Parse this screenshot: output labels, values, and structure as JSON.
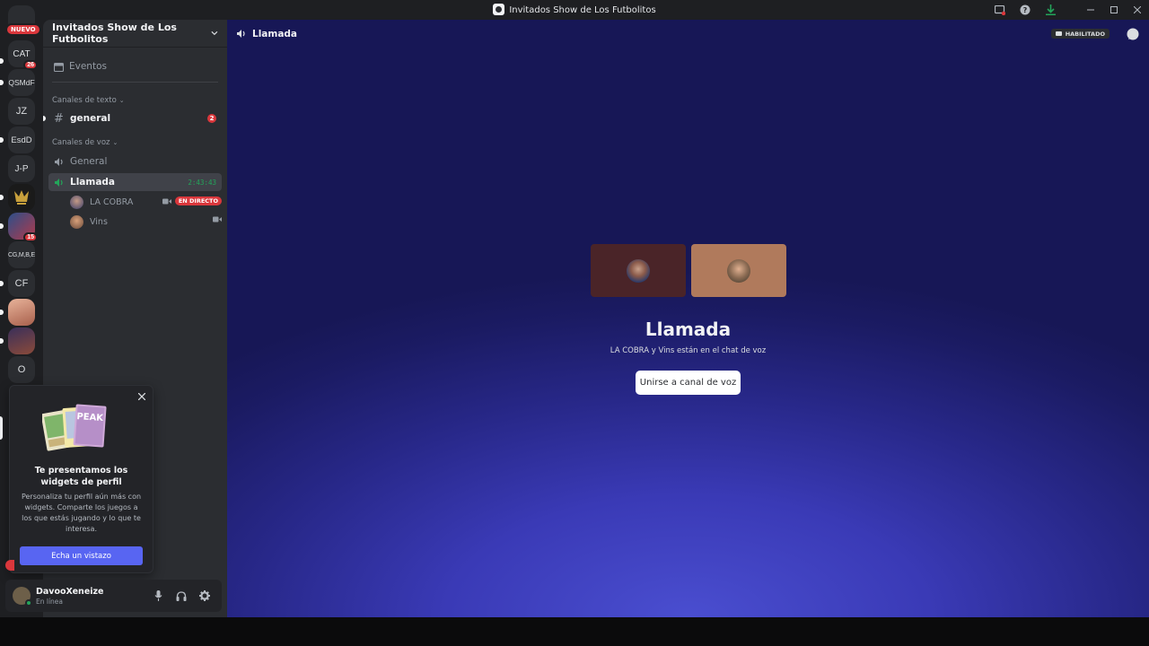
{
  "window": {
    "title": "Invitados Show de Los Futbolitos"
  },
  "rail": {
    "new_badge": "NUEVO",
    "servers": [
      {
        "label": "CAT",
        "badge": "26"
      },
      {
        "label": "QSMdF",
        "badge": ""
      },
      {
        "label": "JZ",
        "badge": ""
      },
      {
        "label": "EsdD",
        "badge": ""
      },
      {
        "label": "J-P",
        "badge": ""
      },
      {
        "label": "",
        "badge": ""
      },
      {
        "label": "",
        "badge": "15"
      },
      {
        "label": "CG,M,B,E",
        "badge": ""
      },
      {
        "label": "CF",
        "badge": ""
      },
      {
        "label": "",
        "badge": ""
      },
      {
        "label": "",
        "badge": ""
      },
      {
        "label": "O",
        "badge": ""
      }
    ]
  },
  "sidebar": {
    "guild_name": "Invitados Show de Los Futbolitos",
    "events_label": "Eventos",
    "text_category": "Canales de texto",
    "voice_category": "Canales de voz",
    "text_channels": [
      {
        "name": "general",
        "mentions": "2"
      }
    ],
    "voice_channels": [
      {
        "name": "General"
      },
      {
        "name": "Llamada",
        "timer": "2:43:43"
      }
    ],
    "voice_users": [
      {
        "name": "LA COBRA",
        "live": "EN DIRECTO"
      },
      {
        "name": "Vins"
      }
    ]
  },
  "popup": {
    "art_text": "PEAK",
    "title": "Te presentamos los widgets de perfil",
    "body": "Personaliza tu perfil aún más con widgets. Comparte los juegos a los que estás jugando y lo que te interesa.",
    "button": "Echa un vistazo"
  },
  "user": {
    "name": "DavooXeneize",
    "status": "En línea"
  },
  "main": {
    "channel_name": "Llamada",
    "habilitado": "HABILITADO",
    "vc_title": "Llamada",
    "vc_subtitle": "LA COBRA y Vins están en el chat de voz",
    "join_button": "Unirse a canal de voz"
  },
  "colors": {
    "accent": "#5865f2",
    "danger": "#da373c",
    "online": "#23a55a",
    "tile1": "#4a2428",
    "tile2": "#b07a5c"
  }
}
